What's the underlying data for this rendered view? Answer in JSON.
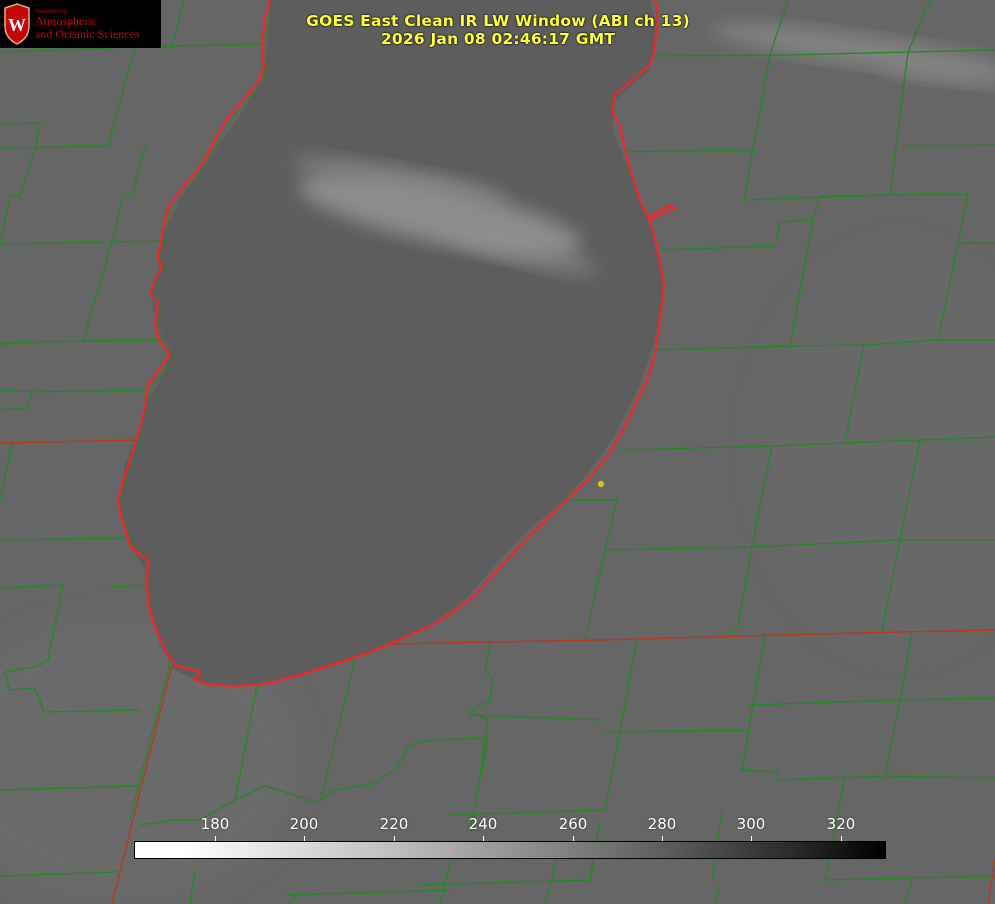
{
  "title": {
    "line1": "GOES East Clean IR LW Window (ABI ch 13)",
    "line2": "2026 Jan 08 02:46:17 GMT"
  },
  "logo": {
    "department": "Department of",
    "line1": "Atmospheric",
    "line2": "and Oceanic Sciences",
    "seal_letter": "W"
  },
  "colorbar": {
    "ticks": [
      "180",
      "200",
      "220",
      "240",
      "260",
      "280",
      "300",
      "320"
    ]
  },
  "colors": {
    "county_lines": "#1f8a1f",
    "state_lines": "#b5391a",
    "coastline": "#ff2020",
    "title_text": "#ffff33",
    "background_land": "#666666",
    "lake_surface": "#5e5e5e",
    "marker": "#d4c21a"
  }
}
